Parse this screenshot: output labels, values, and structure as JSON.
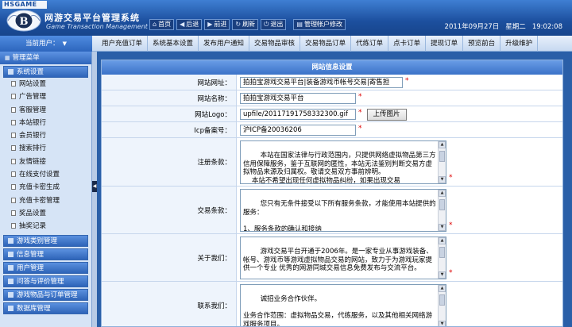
{
  "header": {
    "brand_tag": "HSGAME",
    "title": "网游交易平台管理系统",
    "subtitle": "Game Transaction Management System",
    "nav": [
      {
        "icon": "home-icon",
        "glyph": "⌂",
        "label": "首页"
      },
      {
        "icon": "back-icon",
        "glyph": "◀",
        "label": "后退"
      },
      {
        "icon": "forward-icon",
        "glyph": "▶",
        "label": "前进"
      },
      {
        "icon": "refresh-icon",
        "glyph": "↻",
        "label": "刷新"
      },
      {
        "icon": "logout-icon",
        "glyph": "⏻",
        "label": "退出"
      },
      {
        "icon": "account-icon",
        "glyph": "▤",
        "label": "管理帐户修改"
      }
    ],
    "date": "2011年09月27日",
    "weekday": "星期二",
    "time": "19:02:08"
  },
  "topbar": {
    "current_user_label": "当前用户：",
    "tabs": [
      "用户充值订单",
      "系统基本设置",
      "发布用户通知",
      "交易物品审核",
      "交易物品订单",
      "代练订单",
      "点卡订单",
      "提现订单",
      "预览前台",
      "升级维护"
    ]
  },
  "sidebar": {
    "menu_title": "管理菜单",
    "sections": [
      {
        "label": "系统设置",
        "items": [
          "网站设置",
          "广告管理",
          "客服管理",
          "本站银行",
          "会员银行",
          "搜索排行",
          "友情链接",
          "在线支付设置",
          "充值卡密生成",
          "充值卡密管理",
          "奖品设置",
          "抽奖记录"
        ]
      },
      {
        "label": "游戏类别管理",
        "items": []
      },
      {
        "label": "信息管理",
        "items": []
      },
      {
        "label": "用户管理",
        "items": []
      },
      {
        "label": "问答与评价管理",
        "items": []
      },
      {
        "label": "游戏物品与订单管理",
        "items": []
      },
      {
        "label": "数据库管理",
        "items": []
      }
    ]
  },
  "form": {
    "title": "网站信息设置",
    "site_url": {
      "label": "网站网址：",
      "value": "拍拍宝游戏交易平台|装备游戏币帐号交易|寄售担"
    },
    "site_name": {
      "label": "网站名称：",
      "value": "拍拍宝游戏交易平台"
    },
    "site_logo": {
      "label": "网站Logo：",
      "value": "upfile/20117191758332300.gif",
      "button": "上传图片"
    },
    "icp": {
      "label": "Icp备案号：",
      "value": "沪ICP备20036206"
    },
    "register_terms": {
      "label": "注册条款：",
      "value": "本站在国家法律与行政范围内，只提供网络虚拟物品第三方信用保障服务，鉴于互联网的匿性，本站无法鉴别判断交易方虚拟物品来源及归属权。敬请交易双方事前辨明。\n    本站不希望出现任何虚拟物品纠纷，如果出现交易"
    },
    "trade_terms": {
      "label": "交易条款：",
      "value": "您只有无条件接受以下所有服务条款，才能使用本站提供的服务：\n\n1、服务条款的确认和接纳\n    本站服务的所有权和运作权归本站所有。所提供的"
    },
    "about_us": {
      "label": "关于我们：",
      "value": "游戏交易平台开通于2006年。是一家专业从事游戏装备、帐号、游戏币等游戏虚拟物品交易的网站，致力于为游戏玩家提供一个专业 优秀的网游同城交易信息免费发布与交流平台。"
    },
    "contact_us": {
      "label": "联系我们：",
      "value": "诚招业务合作伙伴。\n\n业务合作范围：虚拟物品交易，代练服务，以及其他相关网络游戏服务项目。"
    },
    "required_mark": "*"
  }
}
